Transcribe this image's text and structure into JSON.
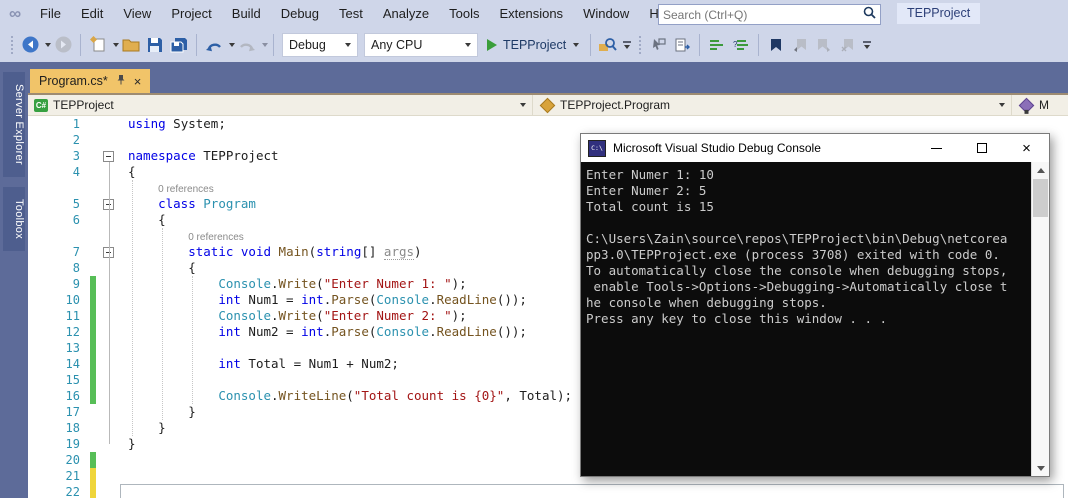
{
  "menu": {
    "items": [
      "File",
      "Edit",
      "View",
      "Project",
      "Build",
      "Debug",
      "Test",
      "Analyze",
      "Tools",
      "Extensions",
      "Window",
      "Help"
    ],
    "search": {
      "placeholder": "Search (Ctrl+Q)"
    },
    "project_badge": "TEPProject"
  },
  "icons": {
    "logo_glyph": "∞",
    "close_glyph": "×",
    "csharp_badge": "C#"
  },
  "toolbar": {
    "configuration": "Debug",
    "platform": "Any CPU",
    "start_project": "TEPProject"
  },
  "side_panel_tabs": [
    {
      "label": "Server Explorer"
    },
    {
      "label": "Toolbox"
    }
  ],
  "document_tab": {
    "title": "Program.cs*"
  },
  "navbar": {
    "project": "TEPProject",
    "type": "TEPProject.Program",
    "member": "M"
  },
  "editor": {
    "rows": [
      {
        "n": "1",
        "segs": [
          {
            "t": "using",
            "c": "kw"
          },
          {
            "t": " System;",
            "c": "pl"
          }
        ]
      },
      {
        "n": "2",
        "segs": []
      },
      {
        "n": "3",
        "fold": true,
        "segs": [
          {
            "t": "namespace",
            "c": "kw"
          },
          {
            "t": " TEPProject",
            "c": "pl"
          }
        ]
      },
      {
        "n": "4",
        "segs": [
          {
            "t": "{",
            "c": "pl"
          }
        ]
      },
      {
        "n": "",
        "segs": [
          {
            "t": "    ",
            "c": "pl"
          },
          {
            "t": "0 references",
            "c": "lens"
          }
        ]
      },
      {
        "n": "5",
        "fold": true,
        "segs": [
          {
            "t": "    ",
            "c": "pl"
          },
          {
            "t": "class",
            "c": "kw"
          },
          {
            "t": " ",
            "c": "pl"
          },
          {
            "t": "Program",
            "c": "ty"
          }
        ]
      },
      {
        "n": "6",
        "segs": [
          {
            "t": "    {",
            "c": "pl"
          }
        ]
      },
      {
        "n": "",
        "segs": [
          {
            "t": "        ",
            "c": "pl"
          },
          {
            "t": "0 references",
            "c": "lens"
          }
        ]
      },
      {
        "n": "7",
        "fold": true,
        "segs": [
          {
            "t": "        ",
            "c": "pl"
          },
          {
            "t": "static",
            "c": "kw"
          },
          {
            "t": " ",
            "c": "pl"
          },
          {
            "t": "void",
            "c": "kw"
          },
          {
            "t": " ",
            "c": "pl"
          },
          {
            "t": "Main",
            "c": "mt"
          },
          {
            "t": "(",
            "c": "pl"
          },
          {
            "t": "string",
            "c": "kw"
          },
          {
            "t": "[] ",
            "c": "pl"
          },
          {
            "t": "args",
            "c": "arg"
          },
          {
            "t": ")",
            "c": "pl"
          }
        ]
      },
      {
        "n": "8",
        "segs": [
          {
            "t": "        {",
            "c": "pl"
          }
        ]
      },
      {
        "n": "9",
        "bar": "green",
        "segs": [
          {
            "t": "            ",
            "c": "pl"
          },
          {
            "t": "Console",
            "c": "ty"
          },
          {
            "t": ".",
            "c": "pl"
          },
          {
            "t": "Write",
            "c": "mt"
          },
          {
            "t": "(",
            "c": "pl"
          },
          {
            "t": "\"Enter Numer 1: \"",
            "c": "st"
          },
          {
            "t": ");",
            "c": "pl"
          }
        ]
      },
      {
        "n": "10",
        "bar": "green",
        "segs": [
          {
            "t": "            ",
            "c": "pl"
          },
          {
            "t": "int",
            "c": "kw"
          },
          {
            "t": " Num1 = ",
            "c": "pl"
          },
          {
            "t": "int",
            "c": "kw"
          },
          {
            "t": ".",
            "c": "pl"
          },
          {
            "t": "Parse",
            "c": "mt"
          },
          {
            "t": "(",
            "c": "pl"
          },
          {
            "t": "Console",
            "c": "ty"
          },
          {
            "t": ".",
            "c": "pl"
          },
          {
            "t": "ReadLine",
            "c": "mt"
          },
          {
            "t": "());",
            "c": "pl"
          }
        ]
      },
      {
        "n": "11",
        "bar": "green",
        "segs": [
          {
            "t": "            ",
            "c": "pl"
          },
          {
            "t": "Console",
            "c": "ty"
          },
          {
            "t": ".",
            "c": "pl"
          },
          {
            "t": "Write",
            "c": "mt"
          },
          {
            "t": "(",
            "c": "pl"
          },
          {
            "t": "\"Enter Numer 2: \"",
            "c": "st"
          },
          {
            "t": ");",
            "c": "pl"
          }
        ]
      },
      {
        "n": "12",
        "bar": "green",
        "segs": [
          {
            "t": "            ",
            "c": "pl"
          },
          {
            "t": "int",
            "c": "kw"
          },
          {
            "t": " Num2 = ",
            "c": "pl"
          },
          {
            "t": "int",
            "c": "kw"
          },
          {
            "t": ".",
            "c": "pl"
          },
          {
            "t": "Parse",
            "c": "mt"
          },
          {
            "t": "(",
            "c": "pl"
          },
          {
            "t": "Console",
            "c": "ty"
          },
          {
            "t": ".",
            "c": "pl"
          },
          {
            "t": "ReadLine",
            "c": "mt"
          },
          {
            "t": "());",
            "c": "pl"
          }
        ]
      },
      {
        "n": "13",
        "bar": "green",
        "segs": []
      },
      {
        "n": "14",
        "bar": "green",
        "segs": [
          {
            "t": "            ",
            "c": "pl"
          },
          {
            "t": "int",
            "c": "kw"
          },
          {
            "t": " Total = Num1 + Num2;",
            "c": "pl"
          }
        ]
      },
      {
        "n": "15",
        "bar": "green",
        "segs": []
      },
      {
        "n": "16",
        "bar": "green",
        "segs": [
          {
            "t": "            ",
            "c": "pl"
          },
          {
            "t": "Console",
            "c": "ty"
          },
          {
            "t": ".",
            "c": "pl"
          },
          {
            "t": "WriteLine",
            "c": "mt"
          },
          {
            "t": "(",
            "c": "pl"
          },
          {
            "t": "\"Total count is {0}\"",
            "c": "st"
          },
          {
            "t": ", Total);",
            "c": "pl"
          }
        ]
      },
      {
        "n": "17",
        "segs": [
          {
            "t": "        }",
            "c": "pl"
          }
        ]
      },
      {
        "n": "18",
        "segs": [
          {
            "t": "    }",
            "c": "pl"
          }
        ]
      },
      {
        "n": "19",
        "segs": [
          {
            "t": "}",
            "c": "pl"
          }
        ]
      },
      {
        "n": "20",
        "bar": "green",
        "segs": []
      },
      {
        "n": "21",
        "bar": "yellow",
        "segs": []
      },
      {
        "n": "22",
        "bar": "yellow",
        "segs": []
      }
    ]
  },
  "debug_console": {
    "title": "Microsoft Visual Studio Debug Console",
    "icon_text": "C:\\",
    "lines": [
      "Enter Numer 1: 10",
      "Enter Numer 2: 5",
      "Total count is 15",
      "",
      "C:\\Users\\Zain\\source\\repos\\TEPProject\\bin\\Debug\\netcorea",
      "pp3.0\\TEPProject.exe (process 3708) exited with code 0.",
      "To automatically close the console when debugging stops,",
      " enable Tools->Options->Debugging->Automatically close t",
      "he console when debugging stops.",
      "Press any key to close this window . . ."
    ]
  },
  "colors": {
    "titlebar_bg": "#CFD6E9",
    "tabstrip_bg": "#5D6B99",
    "active_tab": "#F1C469",
    "keyword": "#0000E6",
    "type_name": "#2B91AF",
    "method_name": "#74531F",
    "string_literal": "#A31515",
    "line_number": "#2B91AF",
    "change_saved": "#57BE57",
    "change_unsaved": "#EFD53B",
    "console_bg": "#0C0C0C",
    "console_text": "#CCCCCC"
  }
}
